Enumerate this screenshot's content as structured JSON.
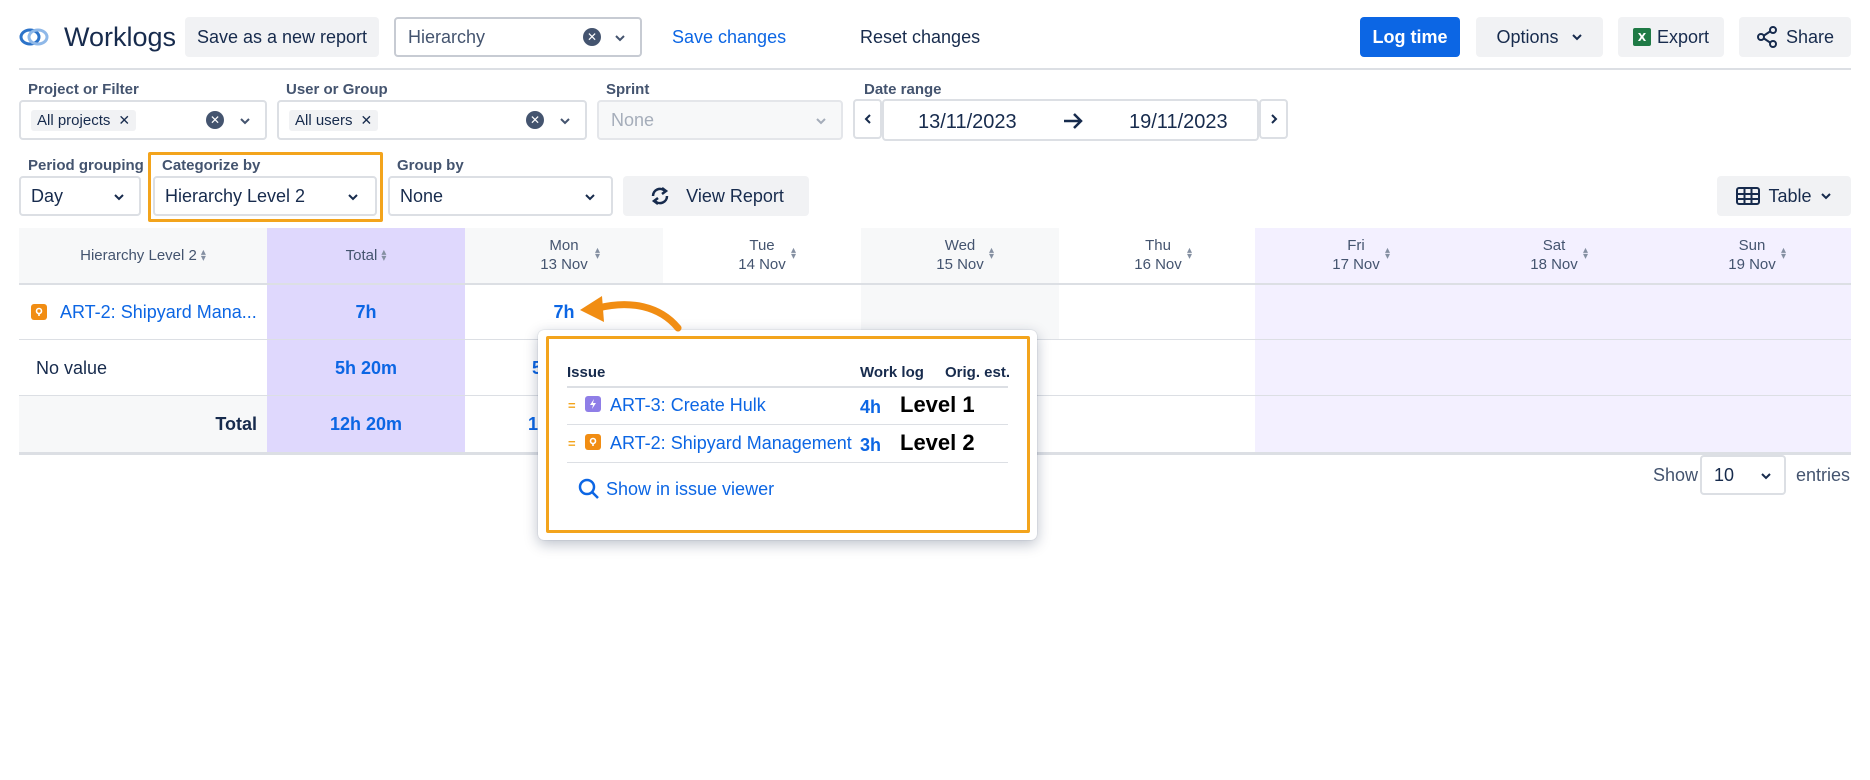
{
  "header": {
    "title": "Worklogs",
    "save_new_label": "Save as a new report",
    "report_name": "Hierarchy",
    "save_changes_label": "Save changes",
    "reset_changes_label": "Reset changes",
    "log_time_label": "Log time",
    "options_label": "Options",
    "export_label": "Export",
    "share_label": "Share"
  },
  "filters": {
    "project": {
      "label": "Project or Filter",
      "tag": "All projects"
    },
    "user": {
      "label": "User or Group",
      "tag": "All users"
    },
    "sprint": {
      "label": "Sprint",
      "placeholder": "None"
    },
    "date_range": {
      "label": "Date range",
      "start": "13/11/2023",
      "end": "19/11/2023"
    },
    "period": {
      "label": "Period grouping",
      "value": "Day"
    },
    "categorize": {
      "label": "Categorize by",
      "value": "Hierarchy Level 2"
    },
    "group": {
      "label": "Group by",
      "value": "None"
    },
    "view_report_label": "View Report",
    "view_mode_label": "Table"
  },
  "table": {
    "col_category": "Hierarchy Level 2",
    "col_total": "Total",
    "days": [
      {
        "name": "Mon",
        "date": "13 Nov"
      },
      {
        "name": "Tue",
        "date": "14 Nov"
      },
      {
        "name": "Wed",
        "date": "15 Nov"
      },
      {
        "name": "Thu",
        "date": "16 Nov"
      },
      {
        "name": "Fri",
        "date": "17 Nov"
      },
      {
        "name": "Sat",
        "date": "18 Nov"
      },
      {
        "name": "Sun",
        "date": "19 Nov"
      }
    ],
    "rows": [
      {
        "label": "ART-2: Shipyard Mana...",
        "total": "7h",
        "mon": "7h"
      },
      {
        "label": "No value",
        "total": "5h 20m",
        "mon": "5"
      }
    ],
    "footer": {
      "label": "Total",
      "total": "12h 20m",
      "mon": "1"
    }
  },
  "pagination": {
    "show_label": "Show",
    "page_size": "10",
    "entries_label": "entries"
  },
  "popup": {
    "col_issue": "Issue",
    "col_worklog": "Work log",
    "col_orig": "Orig. est.",
    "items": [
      {
        "key": "ART-3: Create Hulk",
        "worklog": "4h",
        "note": "Level 1",
        "icon": "epic-icon",
        "color": "#8f7ee7"
      },
      {
        "key": "ART-2: Shipyard Management",
        "worklog": "3h",
        "note": "Level 2",
        "icon": "initiative-icon",
        "color": "#f18d13"
      }
    ],
    "show_viewer_label": "Show in issue viewer"
  },
  "colors": {
    "accent": "#0c66e4",
    "highlight": "#f3a41c",
    "total_col_bg": "#dfd8fd",
    "weekend_bg": "#f3f0ff"
  }
}
